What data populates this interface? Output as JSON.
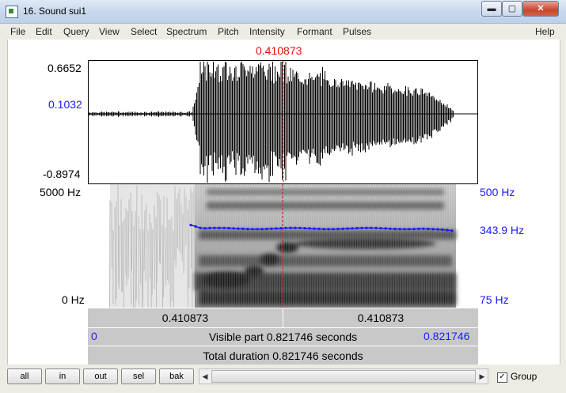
{
  "window": {
    "title": "16. Sound sui1",
    "buttons": {
      "minimize": "▬",
      "maximize": "▢",
      "close": "✕"
    }
  },
  "menu": [
    "File",
    "Edit",
    "Query",
    "View",
    "Select",
    "Spectrum",
    "Pitch",
    "Intensity",
    "Formant",
    "Pulses"
  ],
  "menu_help": "Help",
  "cursor": {
    "time": "0.410873"
  },
  "waveform": {
    "max": "0.6652",
    "cursor_value": "0.1032",
    "min": "-0.8974"
  },
  "spectrogram": {
    "top": "5000 Hz",
    "bottom": "0 Hz"
  },
  "pitch": {
    "top": "500 Hz",
    "value": "343.9 Hz",
    "bottom": "75 Hz"
  },
  "time_bars": {
    "left_cell": "0.410873",
    "right_cell": "0.410873",
    "visible_start": "0",
    "visible_label": "Visible part 0.821746 seconds",
    "visible_end": "0.821746",
    "total_label": "Total duration 0.821746 seconds"
  },
  "buttons": [
    "all",
    "in",
    "out",
    "sel",
    "bak"
  ],
  "group": {
    "label": "Group",
    "checked": true,
    "checkmark": "✓"
  },
  "scrollbar": {
    "left_arrow": "◀",
    "right_arrow": "▶"
  }
}
